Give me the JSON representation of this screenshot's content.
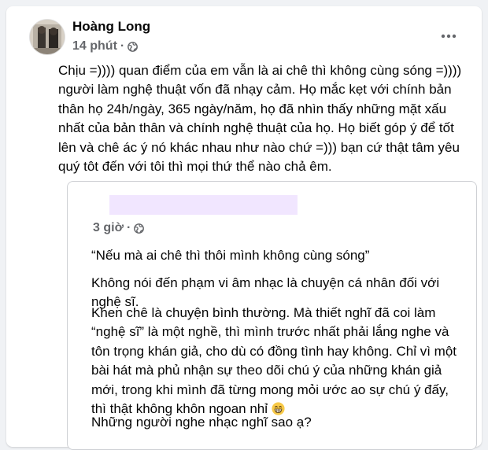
{
  "post": {
    "author": "Hoàng Long",
    "time": "14 phút",
    "separator": "·",
    "privacy_icon": "globe-icon",
    "more_icon": "more-options-icon",
    "text": "Chịu =)))) quan điểm của em vẫn là ai chê thì không cùng sóng =)))) người làm nghệ thuật vốn đã nhạy cảm. Họ mắc kẹt với chính bản thân họ 24h/ngày, 365 ngày/năm, họ đã nhìn thấy những mặt xấu nhất của bản thân và chính nghệ thuật của họ. Họ biết góp ý để tốt lên và chê ác ý nó khác nhau như nào chứ =))) bạn cứ thật tâm yêu quý tôt đến với tôi thì mọi thứ thể nào chả êm."
  },
  "shared_post": {
    "time": "3 giờ",
    "separator": "·",
    "privacy_icon": "globe-icon",
    "paragraphs": [
      "“Nếu mà ai chê thì thôi mình không cùng sóng”",
      "Không nói đến phạm vi âm nhạc là chuyện cá nhân đối với nghệ sĩ.",
      "Khen chê là chuyện bình thường. Mà thiết nghĩ đã coi làm “nghệ sĩ” là một nghề, thì mình trước nhất phải lắng nghe và tôn trọng khán giả, cho dù có đồng tình hay không. Chỉ vì một bài hát mà phủ nhận sự theo dõi chú ý của những khán giả mới, trong khi mình đã từng mong mỏi ước ao sự chú ý đấy, thì thật không khôn ngoan nhỉ",
      "Những người nghe nhạc nghĩ sao ạ?"
    ],
    "emoji": "grinning-face-icon"
  },
  "colors": {
    "text": "#050505",
    "secondary": "#65676b",
    "border": "#ced0d4",
    "redaction": "#f1e6ff",
    "background": "#f0f2f5"
  }
}
